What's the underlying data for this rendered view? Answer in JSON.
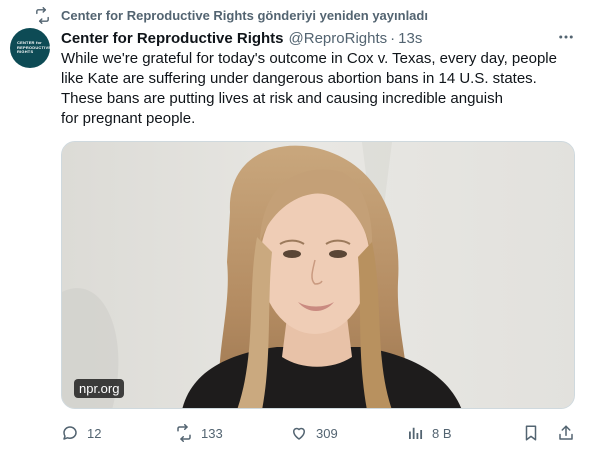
{
  "retweet_context": {
    "icon": "retweet-icon",
    "text": "Center for Reproductive Rights gönderiyi yeniden yayınladı"
  },
  "tweet": {
    "avatar": {
      "lines": [
        "CENTER for",
        "REPRODUCTIVE",
        "RIGHTS"
      ],
      "background": "#0d4b55"
    },
    "author_name": "Center for Reproductive Rights",
    "handle": "@ReproRights",
    "separator": "·",
    "time": "13s",
    "text_lines": [
      "While we're grateful for today's outcome in Cox v. Texas, every day, people",
      "like Kate are suffering under dangerous abortion bans in 14 U.S. states.",
      "These bans are putting lives at risk and causing incredible anguish",
      "for pregnant people."
    ],
    "media": {
      "source_label": "npr.org"
    }
  },
  "actions": {
    "replies": "12",
    "retweets": "133",
    "likes": "309",
    "views": "8 B"
  },
  "colors": {
    "text_primary": "#0f1419",
    "text_secondary": "#536471",
    "border": "#cfd9de"
  }
}
